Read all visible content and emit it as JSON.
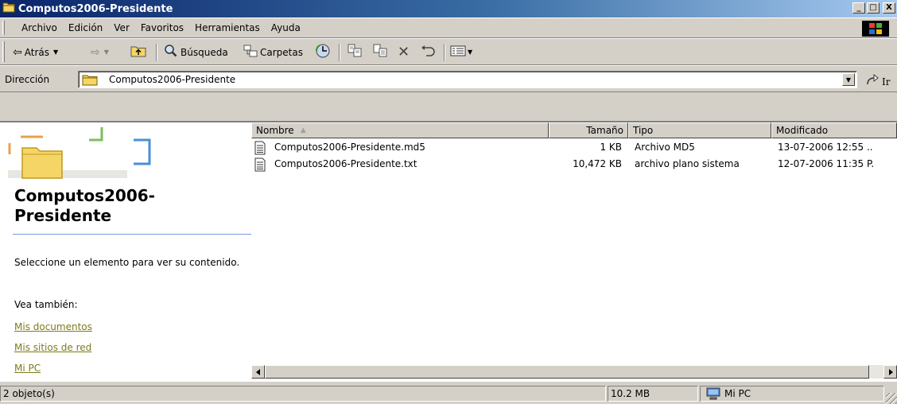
{
  "window": {
    "title": "Computos2006-Presidente",
    "min": "_",
    "max": "□",
    "close": "X"
  },
  "menu": [
    "Archivo",
    "Edición",
    "Ver",
    "Favoritos",
    "Herramientas",
    "Ayuda"
  ],
  "toolbar": {
    "back": "Atrás",
    "search": "Búsqueda",
    "folders": "Carpetas"
  },
  "address": {
    "label": "Dirección",
    "value": "Computos2006-Presidente",
    "go": "Ir"
  },
  "left_panel": {
    "title": "Computos2006-Presidente",
    "description": "Seleccione un elemento para ver su contenido.",
    "see_also": "Vea también:",
    "links": [
      "Mis documentos",
      "Mis sitios de red",
      "Mi PC"
    ]
  },
  "list": {
    "columns": {
      "name": "Nombre",
      "size": "Tamaño",
      "type": "Tipo",
      "modified": "Modificado"
    },
    "sort_indicator": "▲",
    "rows": [
      {
        "name": "Computos2006-Presidente.md5",
        "size": "1 KB",
        "type": "Archivo MD5",
        "modified": "13-07-2006 12:55 .."
      },
      {
        "name": "Computos2006-Presidente.txt",
        "size": "10,472 KB",
        "type": "archivo plano sistema",
        "modified": "12-07-2006 11:35 P."
      }
    ]
  },
  "status": {
    "count": "2 objeto(s)",
    "size": "10.2 MB",
    "location": "Mi PC"
  }
}
